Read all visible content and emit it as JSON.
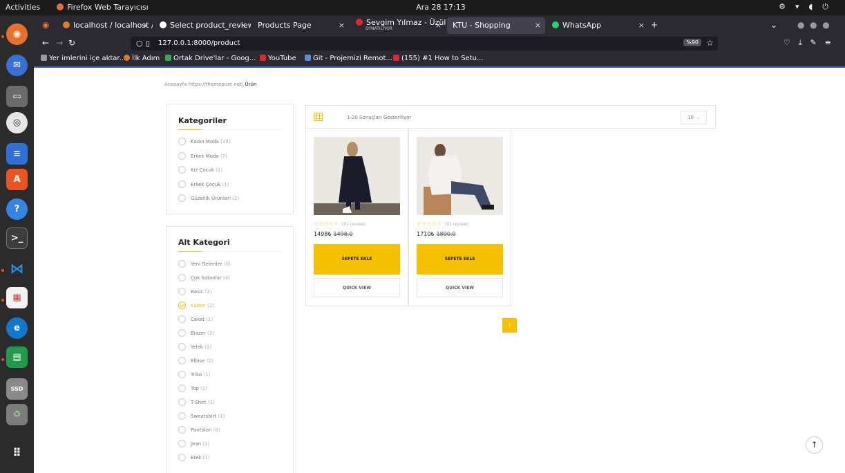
{
  "system": {
    "activities": "Activities",
    "app_name": "Firefox Web Tarayıcısı",
    "clock": "Ara 28  17:13"
  },
  "tabs": [
    {
      "label": "localhost / localhost / ec",
      "active": false,
      "favicon_color": "#e07b2a"
    },
    {
      "label": "Select product_review b",
      "active": false,
      "favicon_color": "#ffffff"
    },
    {
      "label": "Products Page",
      "active": false,
      "favicon_color": ""
    },
    {
      "label": "Sevgim Yılmaz - Üzülme",
      "sub": "OYNATILIYOR",
      "active": false,
      "favicon_color": "#e3262b"
    },
    {
      "label": "KTU - Shopping",
      "active": true,
      "favicon_color": ""
    },
    {
      "label": "WhatsApp",
      "active": false,
      "favicon_color": "#25d366"
    }
  ],
  "urlbar": {
    "url": "127.0.0.1:8000/product",
    "zoom": "%90"
  },
  "bookmarks": [
    {
      "label": "Yer imlerini içe aktar...",
      "color": "#9a9a9a"
    },
    {
      "label": "İlk Adım",
      "color": "#e07b2a"
    },
    {
      "label": "Ortak Drive'lar - Goog...",
      "color": "#34a853"
    },
    {
      "label": "YouTube",
      "color": "#e3262b"
    },
    {
      "label": "Git - Projemizi Remot...",
      "color": "#5a8fd8"
    },
    {
      "label": "(155) #1 How to Setu...",
      "color": "#e3262b"
    }
  ],
  "breadcrumb": {
    "home": "Anasayfa",
    "link": "https://themepure.net/",
    "current": "Ürün"
  },
  "categories": {
    "title": "Kategoriler",
    "items": [
      {
        "name": "Kadın Moda",
        "count": "(24)"
      },
      {
        "name": "Erkek Moda",
        "count": "(7)"
      },
      {
        "name": "Kız Çocuk",
        "count": "(1)"
      },
      {
        "name": "Erkek Çocuk",
        "count": "(1)"
      },
      {
        "name": "Güzellik Ürünleri",
        "count": "(2)"
      }
    ]
  },
  "subcategories": {
    "title": "Alt Kategori",
    "items": [
      {
        "name": "Yeni Gelenler",
        "count": "(0)"
      },
      {
        "name": "Çok Satanlar",
        "count": "(4)"
      },
      {
        "name": "Basic",
        "count": "(2)"
      },
      {
        "name": "Kaban",
        "count": "(2)",
        "checked": true
      },
      {
        "name": "Ceket",
        "count": "(1)"
      },
      {
        "name": "Blazer",
        "count": "(2)"
      },
      {
        "name": "Yelek",
        "count": "(1)"
      },
      {
        "name": "Elbise",
        "count": "(2)"
      },
      {
        "name": "Triko",
        "count": "(1)"
      },
      {
        "name": "Top",
        "count": "(2)"
      },
      {
        "name": "T-Shirt",
        "count": "(1)"
      },
      {
        "name": "Sweatshirt",
        "count": "(1)"
      },
      {
        "name": "Pantolon",
        "count": "(0)"
      },
      {
        "name": "Jean",
        "count": "(1)"
      },
      {
        "name": "Etek",
        "count": "(1)"
      }
    ]
  },
  "toolbar": {
    "result_text": "1-20 Sonuçları Gösteriliyor",
    "per_page": "10"
  },
  "products": [
    {
      "stars": "☆☆☆☆☆",
      "reviews": "(01 review)",
      "price": "1498₺",
      "old_price": "1498.0",
      "add_to_cart": "SEPETE EKLE",
      "quick_view": "QUICK VIEW"
    },
    {
      "stars": "☆☆☆☆☆",
      "reviews": "(01 review)",
      "price": "1710₺",
      "old_price": "1800.0",
      "add_to_cart": "SEPETE EKLE",
      "quick_view": "QUICK VIEW"
    }
  ],
  "pagination": {
    "current": "1"
  },
  "back_to_top": "↑",
  "colors": {
    "accent": "#f5c100",
    "dock": "#2b2b2b",
    "browser_chrome": "#2b2a33"
  }
}
